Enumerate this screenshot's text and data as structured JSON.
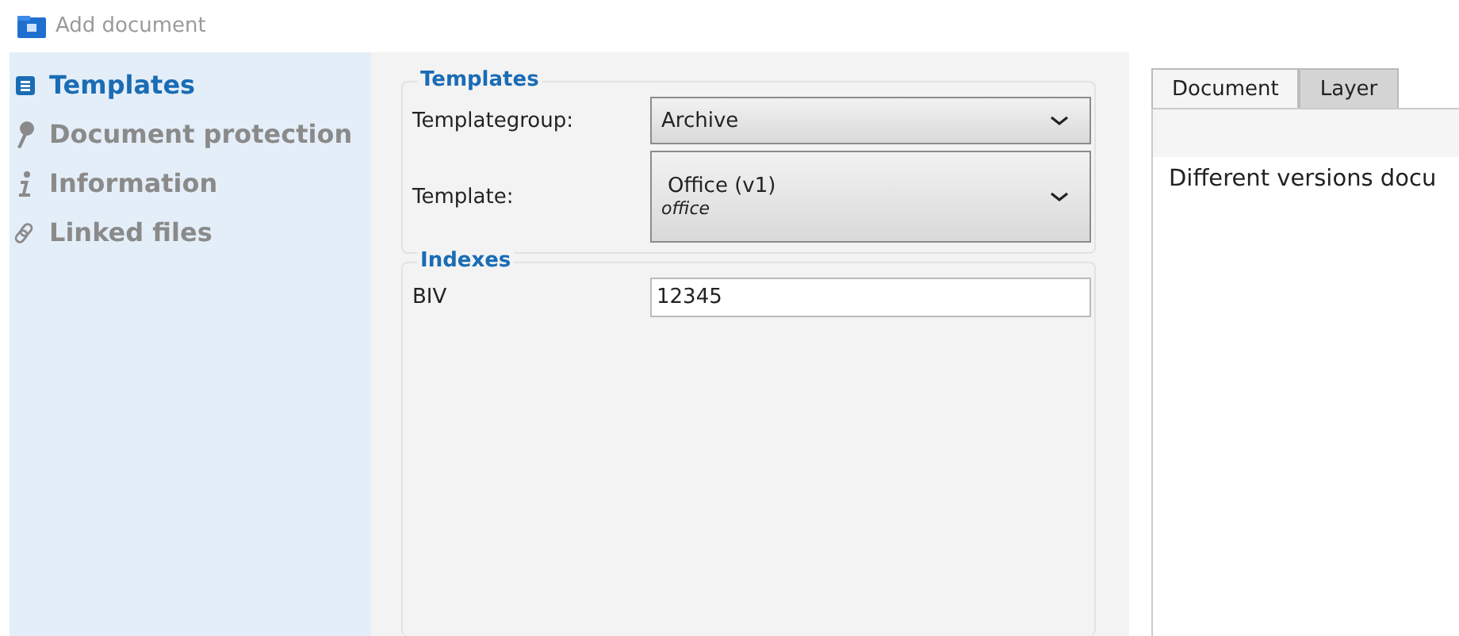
{
  "window": {
    "title": "Add document"
  },
  "sidebar": {
    "items": [
      {
        "label": "Templates",
        "kind": "document",
        "selected": true
      },
      {
        "label": "Document protection",
        "kind": "key",
        "selected": false
      },
      {
        "label": "Information",
        "kind": "info",
        "selected": false
      },
      {
        "label": "Linked files",
        "kind": "link",
        "selected": false
      }
    ]
  },
  "templates": {
    "title": "Templates",
    "fields": [
      {
        "label": "Templategroup:",
        "value": "Archive"
      },
      {
        "label": "Template:",
        "value": "Office (v1)",
        "subtitle": "office"
      }
    ]
  },
  "indexes": {
    "title": "Indexes",
    "fields": [
      {
        "label": "BIV",
        "value": "12345"
      }
    ]
  },
  "tabs": [
    {
      "label": "Document",
      "selected": true
    },
    {
      "label": "Layer",
      "selected": false
    }
  ],
  "tab_content": {
    "text": "Different versions docu"
  }
}
